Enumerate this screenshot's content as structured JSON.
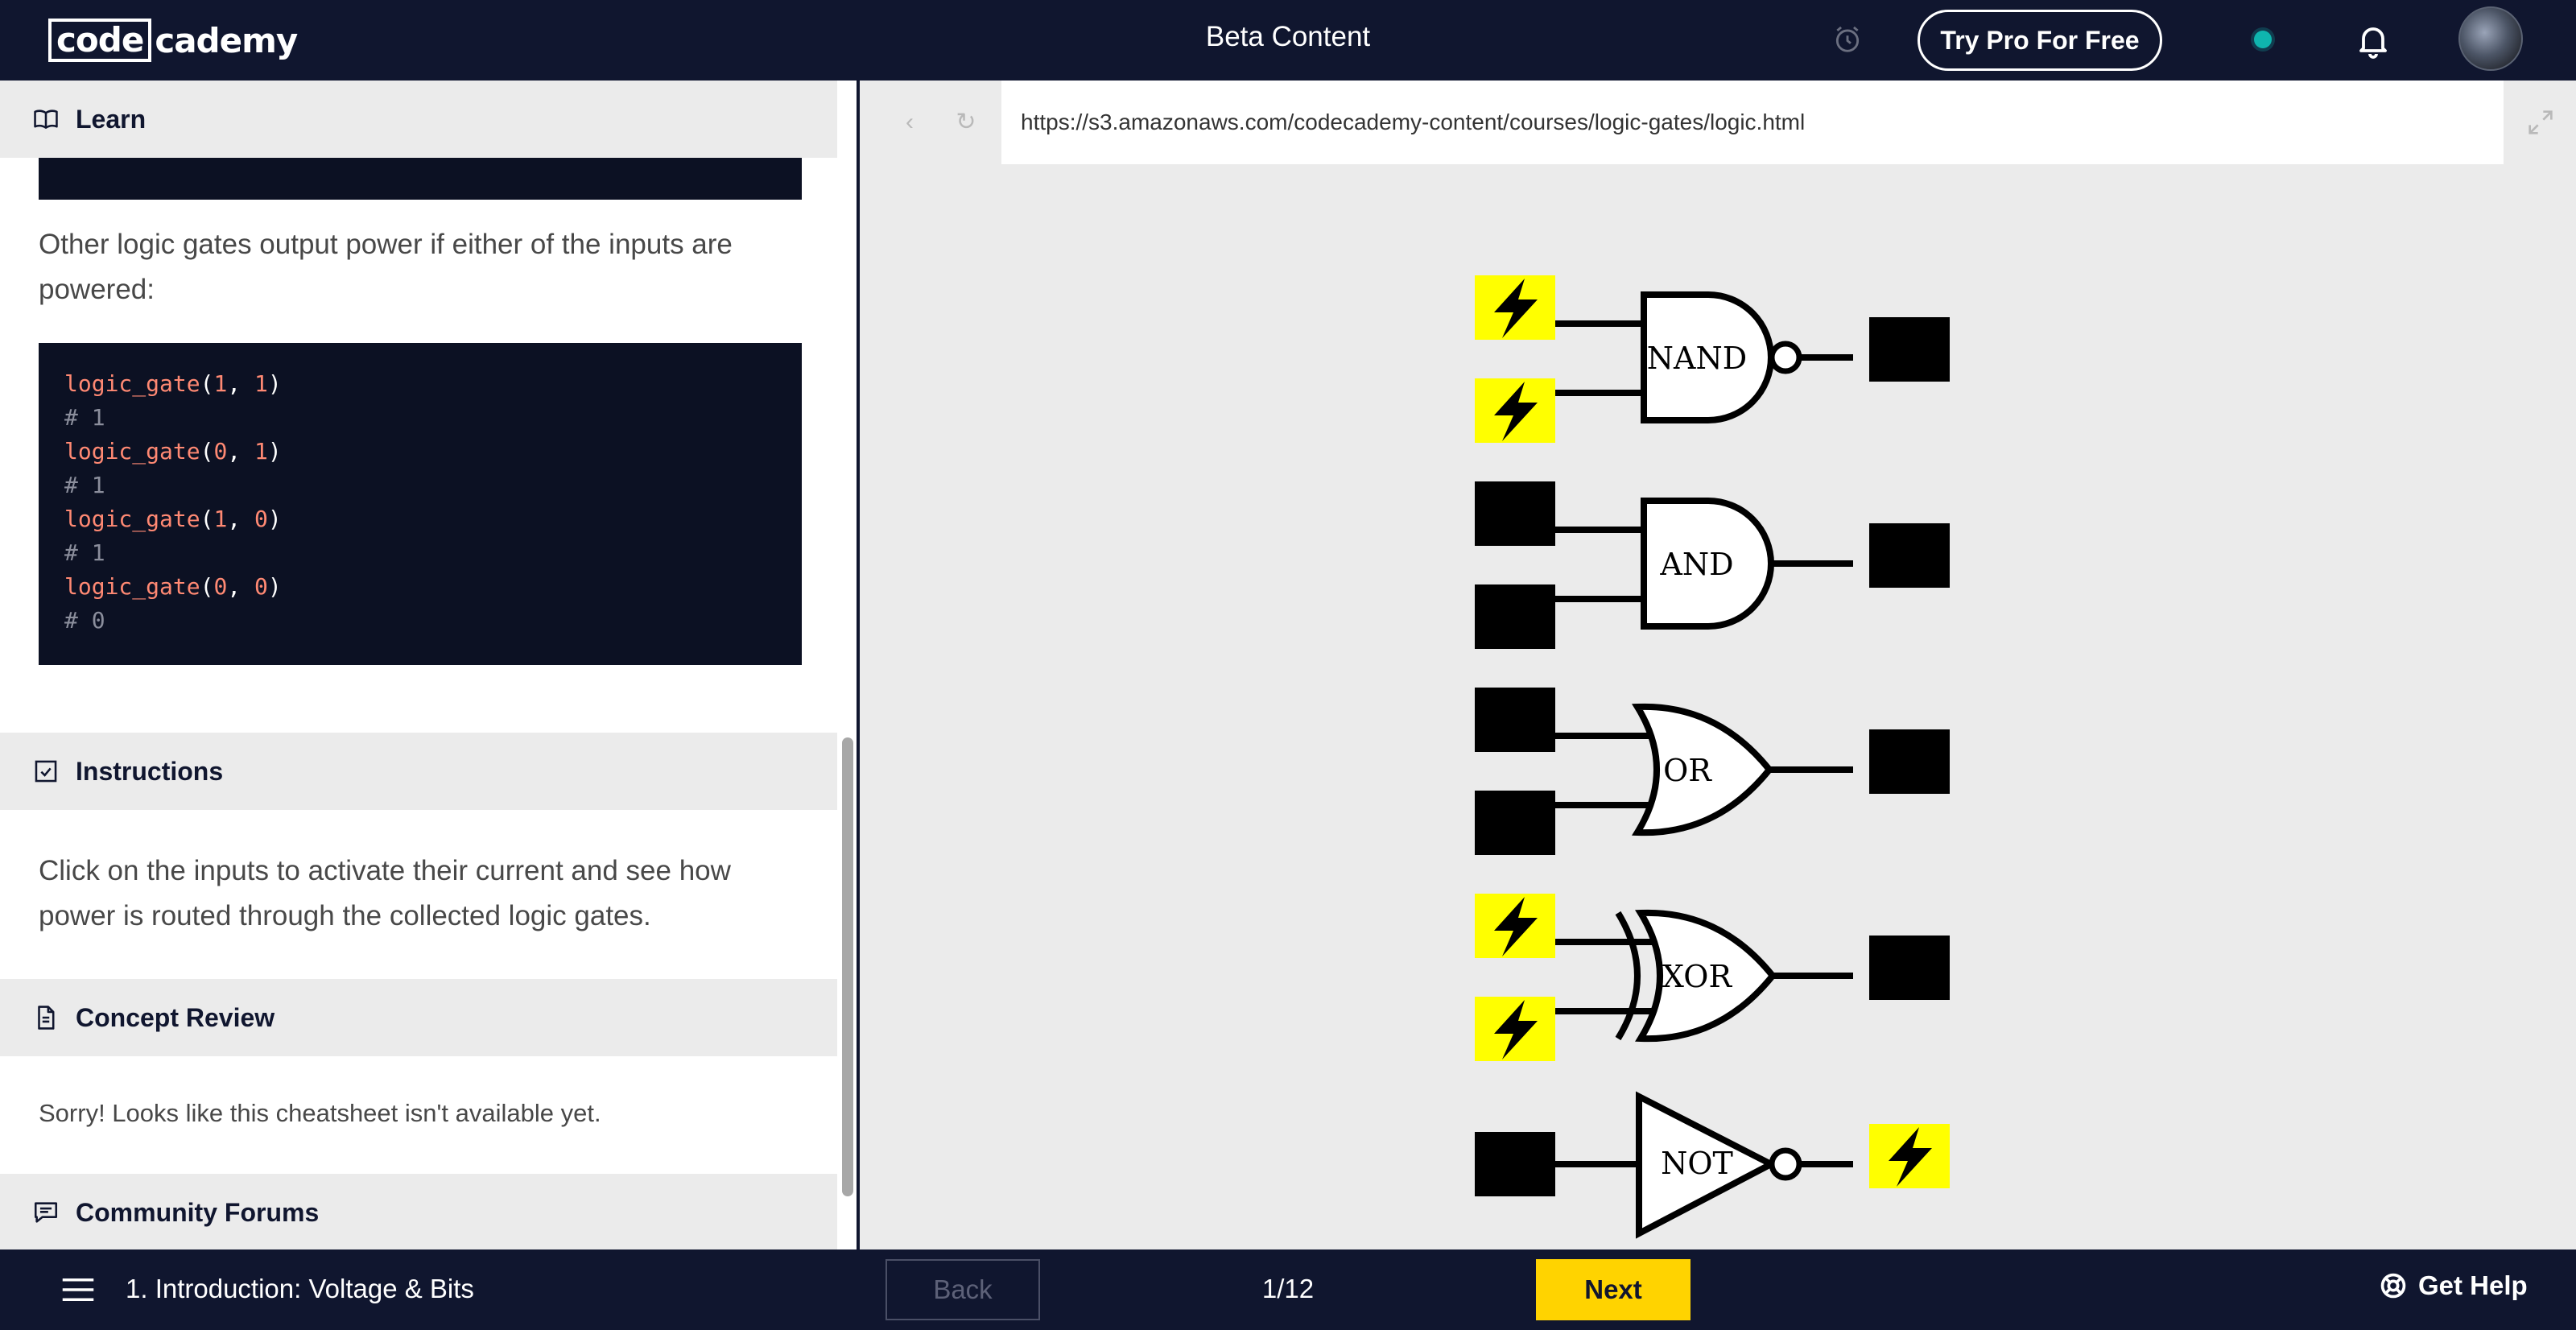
{
  "header": {
    "logo_boxed": "code",
    "logo_rest": "cademy",
    "title": "Beta Content",
    "try_pro_label": "Try Pro For Free"
  },
  "learn": {
    "section_label": "Learn",
    "paragraph": "Other logic gates output power if either of the inputs are powered:",
    "code_lines": [
      {
        "kind": "call",
        "fn": "logic_gate",
        "a": "1",
        "b": "1"
      },
      {
        "kind": "comment",
        "text": "# 1"
      },
      {
        "kind": "call",
        "fn": "logic_gate",
        "a": "0",
        "b": "1"
      },
      {
        "kind": "comment",
        "text": "# 1"
      },
      {
        "kind": "call",
        "fn": "logic_gate",
        "a": "1",
        "b": "0"
      },
      {
        "kind": "comment",
        "text": "# 1"
      },
      {
        "kind": "call",
        "fn": "logic_gate",
        "a": "0",
        "b": "0"
      },
      {
        "kind": "comment",
        "text": "# 0"
      }
    ]
  },
  "instructions": {
    "section_label": "Instructions",
    "text": "Click on the inputs to activate their current and see how power is routed through the collected logic gates."
  },
  "concept_review": {
    "section_label": "Concept Review",
    "text": "Sorry! Looks like this cheatsheet isn't available yet."
  },
  "community": {
    "section_label": "Community Forums"
  },
  "browser": {
    "url": "https://s3.amazonaws.com/codecademy-content/courses/logic-gates/logic.html",
    "back_glyph": "‹",
    "reload_glyph": "↻"
  },
  "gates": [
    {
      "label": "NAND",
      "type": "nand",
      "inputs": [
        true,
        true
      ],
      "output": false
    },
    {
      "label": "AND",
      "type": "and",
      "inputs": [
        false,
        false
      ],
      "output": false
    },
    {
      "label": "OR",
      "type": "or",
      "inputs": [
        false,
        false
      ],
      "output": false
    },
    {
      "label": "XOR",
      "type": "xor",
      "inputs": [
        true,
        true
      ],
      "output": false
    },
    {
      "label": "NOT",
      "type": "not",
      "inputs": [
        false
      ],
      "output": true
    }
  ],
  "colors": {
    "powered": "#ffff00",
    "unpowered": "#000000",
    "next_button": "#ffd300",
    "status_dot": "#0fb5ae",
    "code_bg": "#0c1123",
    "code_fn": "#ff8973"
  },
  "footer": {
    "lesson_title": "1. Introduction: Voltage & Bits",
    "back_label": "Back",
    "progress": "1/12",
    "next_label": "Next",
    "help_label": "Get Help"
  }
}
